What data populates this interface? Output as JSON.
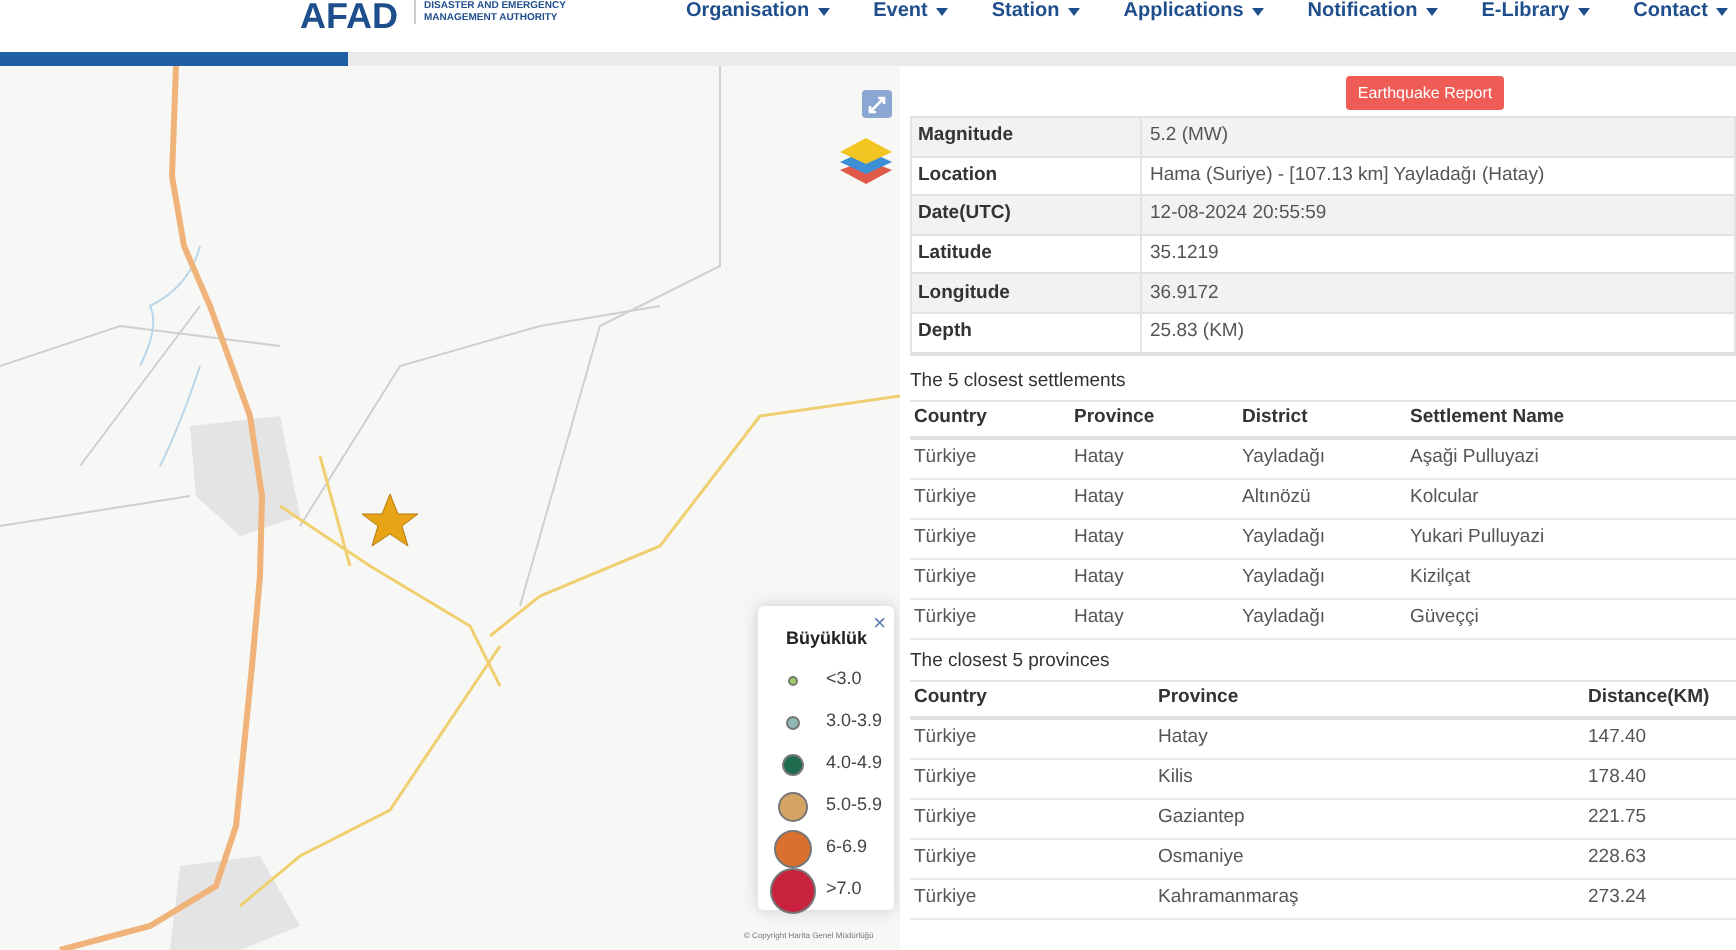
{
  "header": {
    "logo": "AFAD",
    "logo_lines": [
      "DISASTER AND EMERGENCY",
      "MANAGEMENT AUTHORITY"
    ],
    "nav": [
      {
        "label": "Organisation"
      },
      {
        "label": "Event"
      },
      {
        "label": "Station"
      },
      {
        "label": "Applications"
      },
      {
        "label": "Notification"
      },
      {
        "label": "E-Library"
      },
      {
        "label": "Contact"
      }
    ]
  },
  "progress": {
    "level": 0.2
  },
  "map": {
    "legend": {
      "title": "Büyüklük",
      "close": "×",
      "items": [
        {
          "label": "<3.0",
          "color": "#9ccc65"
        },
        {
          "label": "3.0-3.9",
          "color": "#8fb8b2"
        },
        {
          "label": "4.0-4.9",
          "color": "#1f6b4d"
        },
        {
          "label": "5.0-5.9",
          "color": "#d4a464"
        },
        {
          "label": "6-6.9",
          "color": "#d9702f"
        },
        {
          "label": ">7.0",
          "color": "#c8223e"
        }
      ]
    },
    "copyright": "© Copyright Harita Genel Müdürlüğü"
  },
  "report_button": "Earthquake Report",
  "details": [
    {
      "label": "Magnitude",
      "value": "5.2 (MW)"
    },
    {
      "label": "Location",
      "value": "Hama (Suriye) - [107.13 km] Yayladağı (Hatay)"
    },
    {
      "label": "Date(UTC)",
      "value": "12-08-2024 20:55:59"
    },
    {
      "label": "Latitude",
      "value": "35.1219"
    },
    {
      "label": "Longitude",
      "value": "36.9172"
    },
    {
      "label": "Depth",
      "value": "25.83 (KM)"
    }
  ],
  "settlements": {
    "title": "The 5 closest settlements",
    "columns": [
      "Country",
      "Province",
      "District",
      "Settlement Name"
    ],
    "rows": [
      [
        "Türkiye",
        "Hatay",
        "Yayladağı",
        "Aşaği Pulluyazi"
      ],
      [
        "Türkiye",
        "Hatay",
        "Altınözü",
        "Kolcular"
      ],
      [
        "Türkiye",
        "Hatay",
        "Yayladağı",
        "Yukari Pulluyazi"
      ],
      [
        "Türkiye",
        "Hatay",
        "Yayladağı",
        "Kizilçat"
      ],
      [
        "Türkiye",
        "Hatay",
        "Yayladağı",
        "Güveççi"
      ]
    ]
  },
  "provinces": {
    "title": "The closest 5 provinces",
    "columns": [
      "Country",
      "Province",
      "Distance(KM)"
    ],
    "rows": [
      [
        "Türkiye",
        "Hatay",
        "147.40"
      ],
      [
        "Türkiye",
        "Kilis",
        "178.40"
      ],
      [
        "Türkiye",
        "Gaziantep",
        "221.75"
      ],
      [
        "Türkiye",
        "Osmaniye",
        "228.63"
      ],
      [
        "Türkiye",
        "Kahramanmaraş",
        "273.24"
      ]
    ]
  }
}
